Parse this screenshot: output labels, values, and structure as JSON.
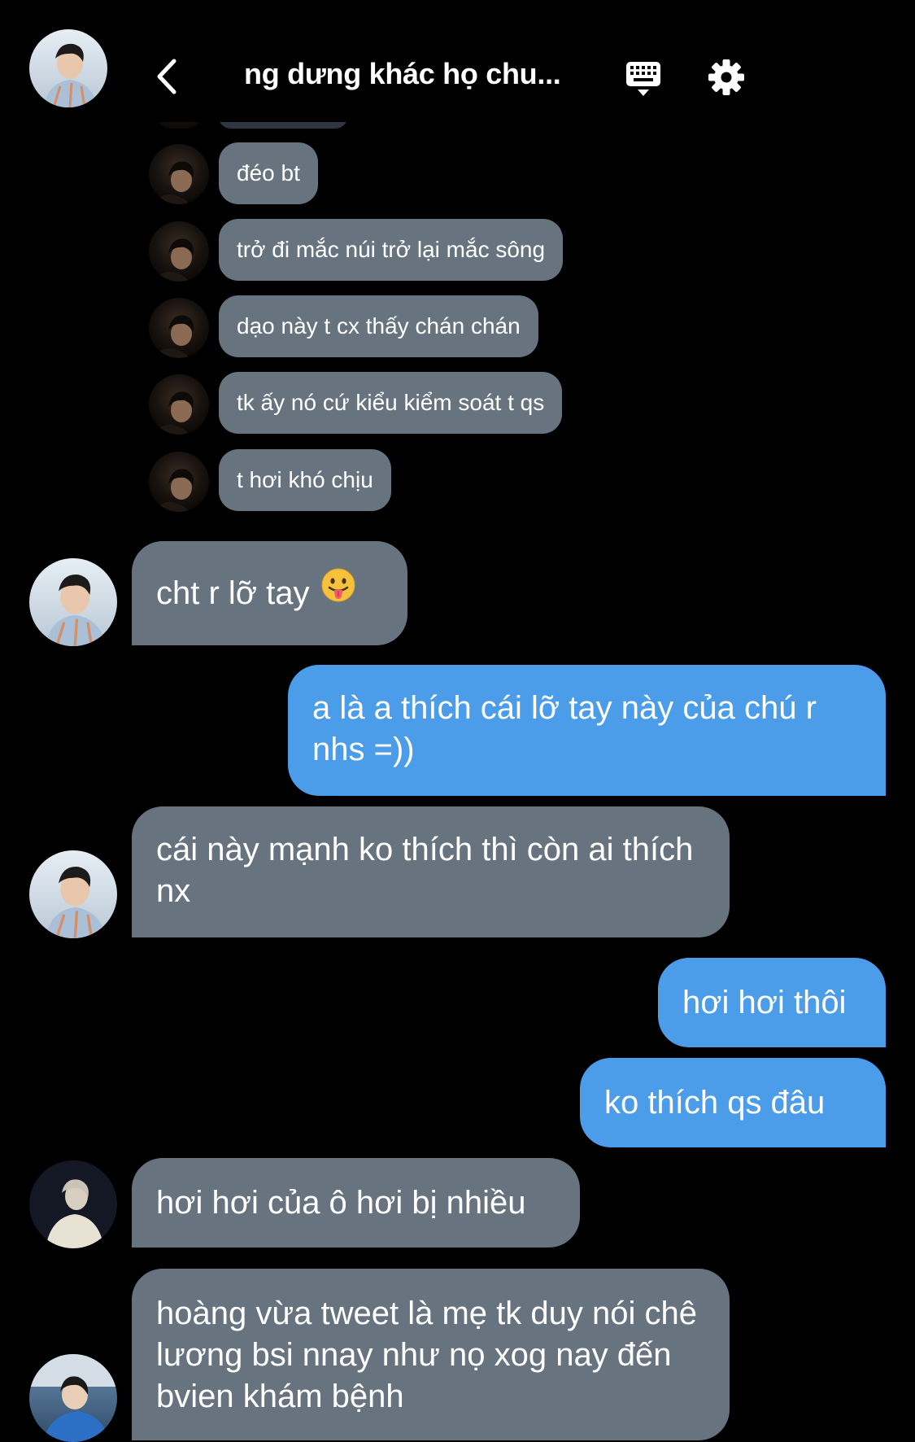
{
  "header": {
    "title": "ng dưng khác họ chu..."
  },
  "colors": {
    "background": "#000000",
    "incoming_bubble": "#67737f",
    "outgoing_bubble": "#4b9ce9",
    "text": "#ffffff"
  },
  "icons": {
    "back": "chevron-left-icon",
    "keyboard": "keyboard-icon",
    "settings": "gear-icon",
    "emoji": "face-with-tongue-emoji"
  },
  "messages": [
    {
      "sender": "other",
      "text": "đéo bt"
    },
    {
      "sender": "other",
      "text": "trở đi mắc núi trở lại mắc sông"
    },
    {
      "sender": "other",
      "text": "dạo này t cx thấy chán chán"
    },
    {
      "sender": "other",
      "text": "tk ấy nó cứ kiểu kiểm soát t qs"
    },
    {
      "sender": "other",
      "text": "t hơi khó chịu"
    },
    {
      "sender": "other",
      "text": "cht r lỡ tay"
    },
    {
      "sender": "me",
      "text": "a là a thích cái lỡ tay này của chú r nhs =))"
    },
    {
      "sender": "other",
      "text": "cái này mạnh ko thích thì còn ai thích nx"
    },
    {
      "sender": "me",
      "text": "hơi hơi thôi"
    },
    {
      "sender": "me",
      "text": "ko thích qs đâu"
    },
    {
      "sender": "other",
      "text": "hơi hơi của ô hơi bị nhiều"
    },
    {
      "sender": "other",
      "text": "hoàng vừa tweet là mẹ tk duy nói chê lương bsi nnay như nọ xog nay đến bvien khám bệnh"
    }
  ]
}
